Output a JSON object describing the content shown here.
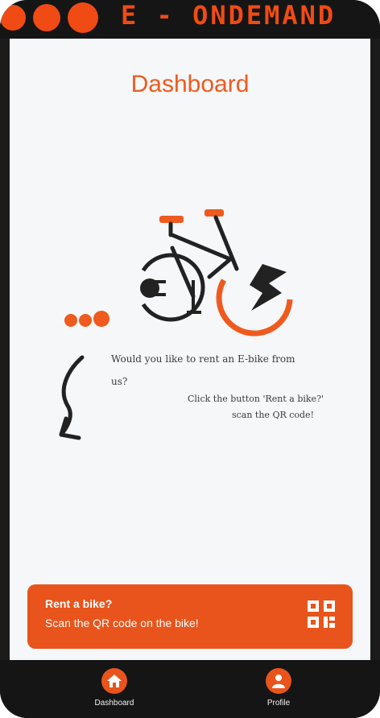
{
  "header": {
    "brand_name": "E - ONDEMAND",
    "brand_color": "#f04b14"
  },
  "dashboard": {
    "title": "Dashboard",
    "question": "Would you like to rent an E-bike from us?",
    "instruction_line1": "Click the button 'Rent a bike?'",
    "instruction_line2": "scan the QR code!"
  },
  "cta": {
    "title": "Rent a bike?",
    "subtitle": "Scan the QR code on the bike!",
    "icon": "qr-code-icon",
    "color": "#e8541b"
  },
  "bottom_nav": {
    "items": [
      {
        "label": "Dashboard",
        "icon": "home-icon",
        "active": true
      },
      {
        "label": "Profile",
        "icon": "user-icon",
        "active": false
      }
    ]
  }
}
